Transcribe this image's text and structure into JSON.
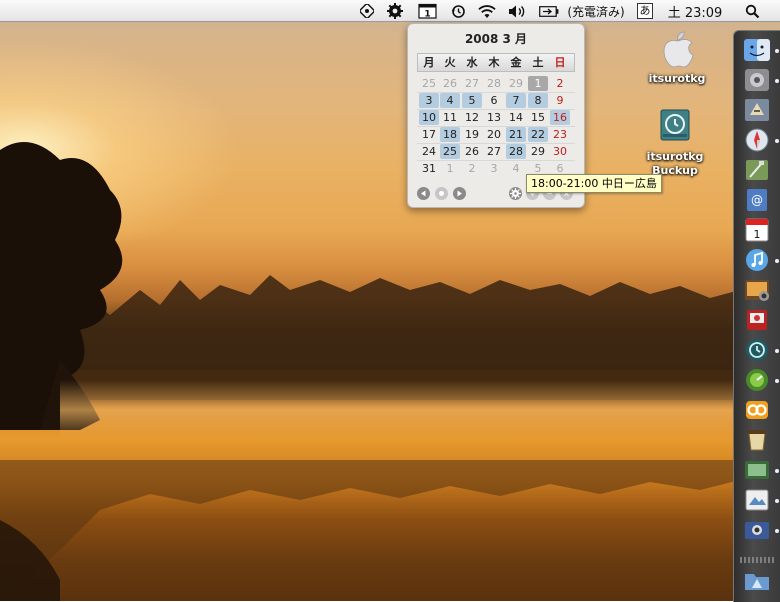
{
  "menubar": {
    "battery_status": "(充電済み)",
    "input_method": "あ",
    "clock": "土 23:09",
    "calendar_icon_day": "1"
  },
  "calendar": {
    "title": "2008 3 月",
    "weekdays": [
      "月",
      "火",
      "水",
      "木",
      "金",
      "土",
      "日"
    ],
    "weeks": [
      [
        {
          "d": "25",
          "s": "muted"
        },
        {
          "d": "26",
          "s": "muted"
        },
        {
          "d": "27",
          "s": "muted"
        },
        {
          "d": "28",
          "s": "muted"
        },
        {
          "d": "29",
          "s": "muted"
        },
        {
          "d": "1",
          "s": "today"
        },
        {
          "d": "2",
          "s": "red"
        }
      ],
      [
        {
          "d": "3",
          "s": "hl"
        },
        {
          "d": "4",
          "s": "hl"
        },
        {
          "d": "5",
          "s": "hl"
        },
        {
          "d": "6",
          "s": ""
        },
        {
          "d": "7",
          "s": "hl"
        },
        {
          "d": "8",
          "s": "hl"
        },
        {
          "d": "9",
          "s": "red"
        }
      ],
      [
        {
          "d": "10",
          "s": "hl"
        },
        {
          "d": "11",
          "s": ""
        },
        {
          "d": "12",
          "s": ""
        },
        {
          "d": "13",
          "s": ""
        },
        {
          "d": "14",
          "s": ""
        },
        {
          "d": "15",
          "s": ""
        },
        {
          "d": "16",
          "s": "hl red"
        }
      ],
      [
        {
          "d": "17",
          "s": ""
        },
        {
          "d": "18",
          "s": "hl"
        },
        {
          "d": "19",
          "s": ""
        },
        {
          "d": "20",
          "s": ""
        },
        {
          "d": "21",
          "s": "hl"
        },
        {
          "d": "22",
          "s": "hl"
        },
        {
          "d": "23",
          "s": "red"
        }
      ],
      [
        {
          "d": "24",
          "s": ""
        },
        {
          "d": "25",
          "s": "hl"
        },
        {
          "d": "26",
          "s": ""
        },
        {
          "d": "27",
          "s": ""
        },
        {
          "d": "28",
          "s": "hl"
        },
        {
          "d": "29",
          "s": ""
        },
        {
          "d": "30",
          "s": "red"
        }
      ],
      [
        {
          "d": "31",
          "s": ""
        },
        {
          "d": "1",
          "s": "muted"
        },
        {
          "d": "2",
          "s": "muted"
        },
        {
          "d": "3",
          "s": "muted"
        },
        {
          "d": "4",
          "s": "muted"
        },
        {
          "d": "5",
          "s": "muted"
        },
        {
          "d": "6",
          "s": "muted"
        }
      ]
    ],
    "tooltip": "18:00-21:00 中日ー広島"
  },
  "desktop_icons": [
    {
      "label_lines": [
        "itsurotkg"
      ],
      "icon": "apple-drive-icon"
    },
    {
      "label_lines": [
        "itsurotkg",
        "Buckup"
      ],
      "icon": "time-machine-drive-icon"
    }
  ],
  "dock": {
    "items": [
      "finder",
      "system-preferences",
      "migration-assistant",
      "safari",
      "script-editor",
      "address-book",
      "ical",
      "itunes",
      "iphoto",
      "photo-booth",
      "time-machine",
      "dashboard",
      "office",
      "stuffit",
      "mail-stationery",
      "preview",
      "image-capture",
      "applications-folder"
    ]
  },
  "colors": {
    "menubar": "#ececec",
    "calendar_highlight": "#b3ccdf",
    "sunday_red": "#c0201a",
    "tooltip_bg": "#ffffc6"
  }
}
